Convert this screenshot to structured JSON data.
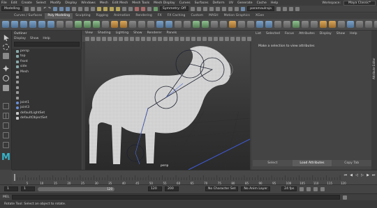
{
  "menubar": {
    "items": [
      "File",
      "Edit",
      "Create",
      "Select",
      "Modify",
      "Display",
      "Windows",
      "Mesh",
      "Edit Mesh",
      "Mesh Tools",
      "Mesh Display",
      "Curves",
      "Surfaces",
      "Deform",
      "UV",
      "Generate",
      "Cache",
      "Help"
    ],
    "workspace_label": "Workspace:",
    "workspace_value": "Maya Classic*"
  },
  "statusline": {
    "mode": "Modelling",
    "symmetry": "Symmetry: Off",
    "user": "paramaulraja"
  },
  "shelf": {
    "tabs": [
      "Curves / Surfaces",
      "Poly Modeling",
      "Sculpting",
      "Rigging",
      "Animation",
      "Rendering",
      "FX",
      "FX Caching",
      "Custom",
      "MASH",
      "Motion Graphics",
      "XGen"
    ],
    "active_tab": "Poly Modeling"
  },
  "outliner": {
    "title": "Outliner",
    "menu": [
      "Display",
      "Show",
      "Help"
    ],
    "search_placeholder": "",
    "items": [
      {
        "label": "persp",
        "icon": "camera-icon"
      },
      {
        "label": "top",
        "icon": "camera-icon"
      },
      {
        "label": "front",
        "icon": "camera-icon"
      },
      {
        "label": "side",
        "icon": "camera-icon"
      },
      {
        "label": "Mesh",
        "icon": "mesh-icon"
      },
      {
        "label": "",
        "icon": "mesh-icon"
      },
      {
        "label": "",
        "icon": "mesh-icon"
      },
      {
        "label": "",
        "icon": "mesh-icon"
      },
      {
        "label": "",
        "icon": "mesh-icon"
      },
      {
        "label": "",
        "icon": "mesh-icon"
      },
      {
        "label": "joint1",
        "icon": "joint-icon"
      },
      {
        "label": "joint3",
        "icon": "joint-icon"
      },
      {
        "label": "defaultLightSet",
        "icon": "set-icon"
      },
      {
        "label": "defaultObjectSet",
        "icon": "set-icon"
      }
    ]
  },
  "viewport": {
    "menu": [
      "View",
      "Shading",
      "Lighting",
      "Show",
      "Renderer",
      "Panels"
    ],
    "camera_label": "persp"
  },
  "attribute_editor": {
    "menu": [
      "List",
      "Selected",
      "Focus",
      "Attributes",
      "Display",
      "Show",
      "Help"
    ],
    "message": "Make a selection to view attributes",
    "buttons": [
      "Select",
      "Load Attributes",
      "Copy Tab"
    ],
    "selected_button": "Load Attributes",
    "side_tab": "Attribute Editor"
  },
  "timeline": {
    "tick_labels": [
      "5",
      "10",
      "15",
      "20",
      "25",
      "30",
      "35",
      "40",
      "45",
      "50",
      "55",
      "60",
      "65",
      "70",
      "75",
      "80",
      "85",
      "90",
      "95",
      "100",
      "105",
      "110",
      "115",
      "120"
    ],
    "current_frame": "1"
  },
  "range": {
    "start": "1",
    "inner_start": "1",
    "bar_label": "120",
    "inner_end": "120",
    "end": "200",
    "character_set": "No Character Set",
    "anim_layer": "No Anim Layer",
    "fps": "24 fps"
  },
  "command": {
    "label": "MEL"
  },
  "help_line": "Rotate Tool: Select an object to rotate.",
  "colors": {
    "accent": "#5b9bd5",
    "background": "#444444"
  }
}
